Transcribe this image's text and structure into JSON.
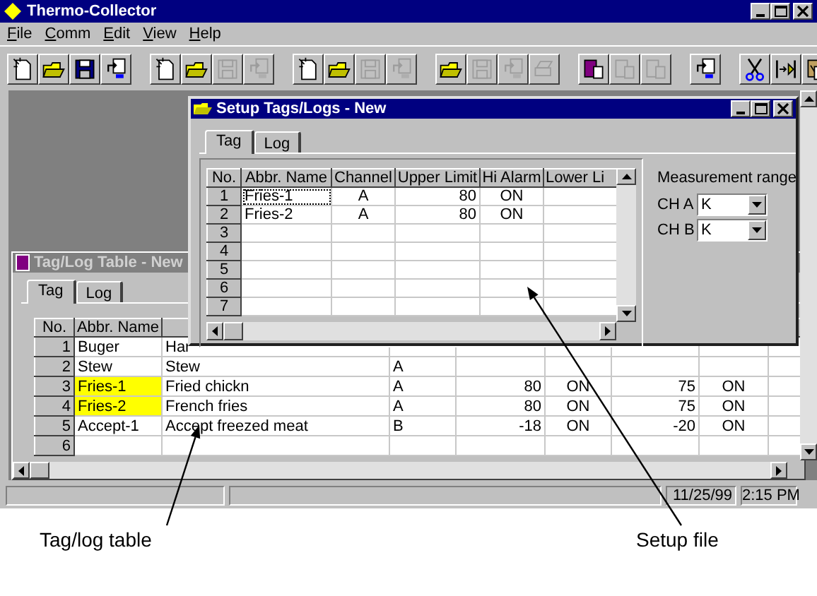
{
  "window": {
    "title": "Thermo-Collector"
  },
  "menu": [
    {
      "label": "File"
    },
    {
      "label": "Comm"
    },
    {
      "label": "Edit"
    },
    {
      "label": "View"
    },
    {
      "label": "Help"
    }
  ],
  "toolbar": [
    [
      {
        "kind": "new",
        "disabled": false
      },
      {
        "kind": "open",
        "disabled": false
      },
      {
        "kind": "save",
        "disabled": false
      },
      {
        "kind": "export",
        "disabled": false
      }
    ],
    [
      {
        "kind": "new",
        "disabled": false
      },
      {
        "kind": "open",
        "disabled": false
      },
      {
        "kind": "save",
        "disabled": true
      },
      {
        "kind": "export",
        "disabled": true
      }
    ],
    [
      {
        "kind": "new",
        "disabled": false
      },
      {
        "kind": "open",
        "disabled": false
      },
      {
        "kind": "save",
        "disabled": true
      },
      {
        "kind": "export",
        "disabled": true
      }
    ],
    [
      {
        "kind": "open",
        "disabled": false
      },
      {
        "kind": "save",
        "disabled": true
      },
      {
        "kind": "export",
        "disabled": true
      },
      {
        "kind": "print",
        "disabled": true
      }
    ],
    [
      {
        "kind": "book",
        "disabled": false
      },
      {
        "kind": "book",
        "disabled": true
      },
      {
        "kind": "book",
        "disabled": true
      }
    ],
    [
      {
        "kind": "export",
        "disabled": false
      }
    ],
    [
      {
        "kind": "cut",
        "disabled": false
      },
      {
        "kind": "fit",
        "disabled": false
      },
      {
        "kind": "paste",
        "disabled": false
      }
    ]
  ],
  "tag_log_window": {
    "title": "Tag/Log Table - New",
    "active": false,
    "tabs": [
      {
        "label": "Tag",
        "selected": true
      },
      {
        "label": "Log",
        "selected": false
      }
    ],
    "table": {
      "columns": [
        "No.",
        "Abbr. Name"
      ],
      "rows": [
        {
          "no": "1",
          "abbr_name": "Buger",
          "column_3": "Har",
          "highlighted": false
        },
        {
          "no": "2",
          "abbr_name": "Stew",
          "column_3": "Stew",
          "column_4": "A",
          "highlighted": false
        },
        {
          "no": "3",
          "abbr_name": "Fries-1",
          "column_3": "Fried chickn",
          "column_4": "A",
          "column_5": "80",
          "column_6": "ON",
          "column_7": "75",
          "column_8": "ON",
          "highlighted": true
        },
        {
          "no": "4",
          "abbr_name": "Fries-2",
          "column_3": "French fries",
          "column_4": "A",
          "column_5": "80",
          "column_6": "ON",
          "column_7": "75",
          "column_8": "ON",
          "highlighted": true
        },
        {
          "no": "5",
          "abbr_name": "Accept-1",
          "column_3": "Accept freezed meat",
          "column_4": "B",
          "column_5": "-18",
          "column_6": "ON",
          "column_7": "-20",
          "column_8": "ON",
          "highlighted": false
        },
        {
          "no": "6",
          "highlighted": false
        }
      ]
    }
  },
  "setup_window": {
    "title": "Setup Tags/Logs - New",
    "active": true,
    "tabs": [
      {
        "label": "Tag",
        "selected": true
      },
      {
        "label": "Log",
        "selected": false
      }
    ],
    "table": {
      "columns": [
        "No.",
        "Abbr. Name",
        "Channel",
        "Upper Limit",
        "Hi Alarm",
        "Lower Li"
      ],
      "rows": [
        {
          "no": "1",
          "abbr_name": "Fries-1",
          "channel": "A",
          "upper_limit": "80",
          "hi_alarm": "ON",
          "focused": true
        },
        {
          "no": "2",
          "abbr_name": "Fries-2",
          "channel": "A",
          "upper_limit": "80",
          "hi_alarm": "ON",
          "focused": false
        },
        {
          "no": "3",
          "focused": false
        },
        {
          "no": "4",
          "focused": false
        },
        {
          "no": "5",
          "focused": false
        },
        {
          "no": "6",
          "focused": false
        },
        {
          "no": "7",
          "focused": false
        }
      ]
    },
    "measurement_range": {
      "label": "Measurement range",
      "channels": [
        {
          "label": "CH A",
          "value": "K"
        },
        {
          "label": "CH B",
          "value": "K"
        }
      ]
    }
  },
  "status_bar": {
    "date": "11/25/99",
    "time": "2:15 PM"
  },
  "annotations": [
    {
      "label": "Tag/log table"
    },
    {
      "label": "Setup file"
    }
  ]
}
